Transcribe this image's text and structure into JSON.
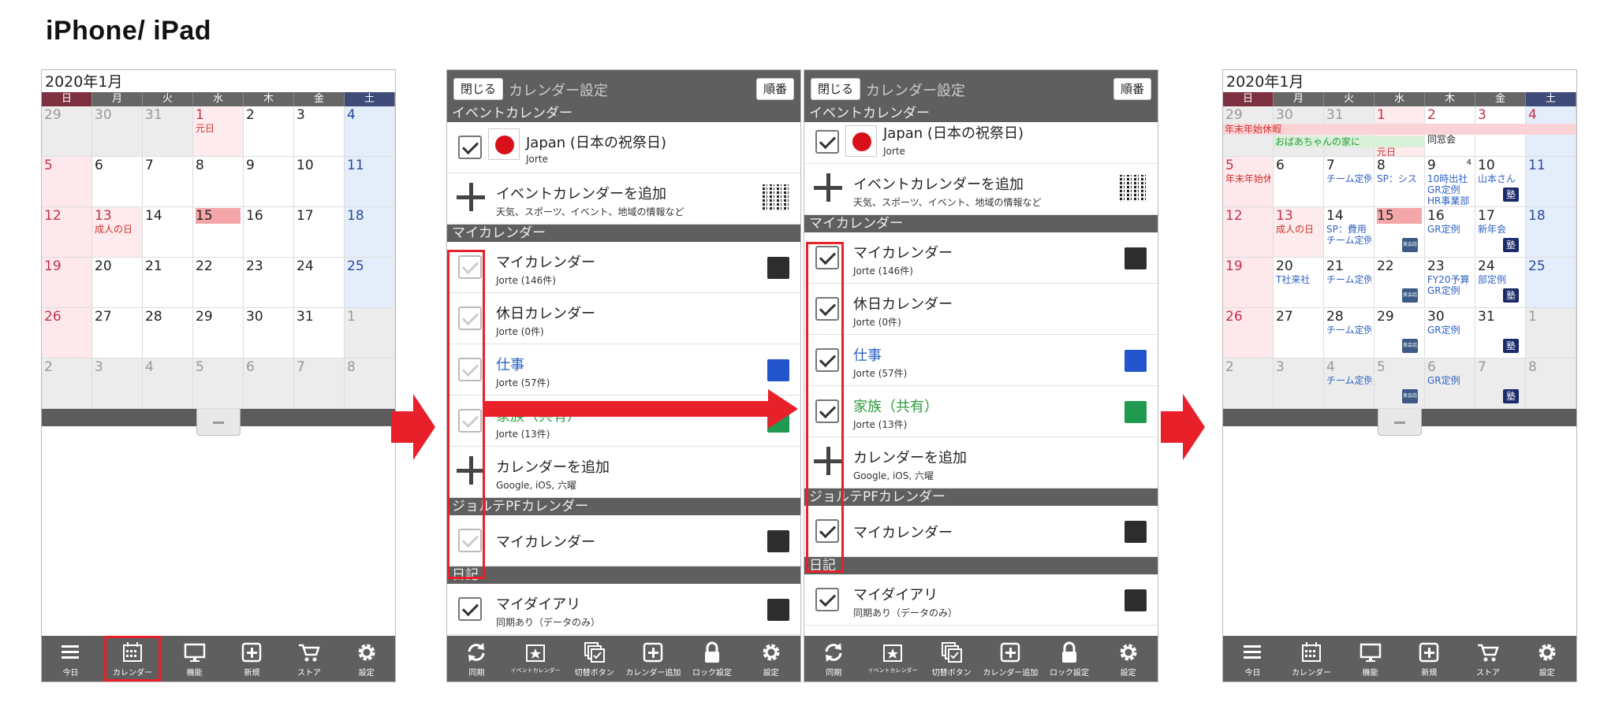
{
  "heading": "iPhone/ iPad",
  "calendar": {
    "month_title": "2020年1月",
    "weekdays": [
      "日",
      "月",
      "火",
      "水",
      "木",
      "金",
      "土"
    ]
  },
  "tabbar_main": [
    "今日",
    "カレンダー",
    "機能",
    "新規",
    "ストア",
    "設定"
  ],
  "tabbar_settings": [
    "同期",
    "イベントカレンダー",
    "切替ボタン",
    "カレンダー追加",
    "ロック設定",
    "設定"
  ],
  "settings": {
    "close": "閉じる",
    "title": "カレンダー設定",
    "order": "順番",
    "sec_event": "イベントカレンダー",
    "japan_title": "Japan (日本の祝祭日)",
    "japan_sub": "Jorte",
    "add_event_title": "イベントカレンダーを追加",
    "add_event_sub": "天気、スポーツ、イベント、地域の情報など",
    "sec_my": "マイカレンダー",
    "my_cal_title": "マイカレンダー",
    "my_cal_sub": "Jorte (146件)",
    "holiday_title": "休日カレンダー",
    "holiday_sub": "Jorte (0件)",
    "work_title": "仕事",
    "work_sub": "Jorte (57件)",
    "family_title": "家族（共有）",
    "family_sub": "Jorte (13件)",
    "add_cal_title": "カレンダーを追加",
    "add_cal_sub": "Google, iOS, 六曜",
    "sec_pf": "ジョルテPFカレンダー",
    "pf_title": "マイカレンダー",
    "sec_diary": "日記",
    "diary_title": "マイダイアリ",
    "diary_sub": "同期あり（データのみ）"
  },
  "colors": {
    "accent_red": "#e8202a",
    "black": "#2d2d2d",
    "blue": "#2255cc",
    "green": "#1f9a50"
  },
  "events": {
    "gantan": "元日",
    "seijin": "成人の日",
    "nenmatsu": "年末年始休暇",
    "nenmatsu2": "年末年始休",
    "obaachan": "おばあちゃんの家に",
    "dousoukai": "同窓会",
    "team": "チーム定例",
    "sp_system": "SP：シス",
    "sp_cost": "SP：費用",
    "dep10": "10時出社",
    "gr": "GR定例",
    "hr": "HR事業部",
    "yamamoto": "山本さん",
    "shinnenkai": "新年会",
    "tsha": "T社来社",
    "fy20": "FY20予算",
    "bumon": "部定例",
    "juku": "塾",
    "bikai": "美会話",
    "four": "4"
  }
}
